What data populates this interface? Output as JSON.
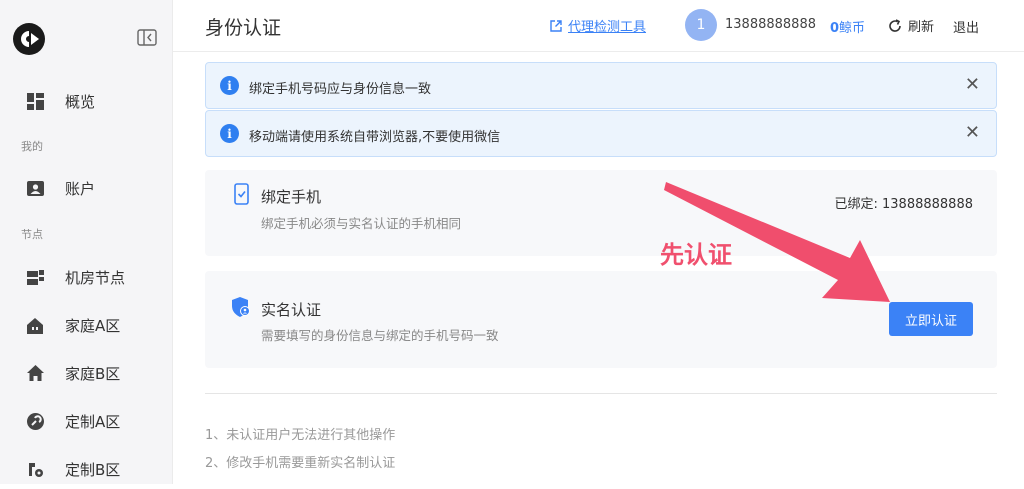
{
  "sidebar": {
    "items": [
      {
        "label": "概览",
        "icon": "dashboard-icon"
      },
      {
        "group": "我的"
      },
      {
        "label": "账户",
        "icon": "account-icon"
      },
      {
        "group": "节点"
      },
      {
        "label": "机房节点",
        "icon": "server-icon"
      },
      {
        "label": "家庭A区",
        "icon": "home-a-icon"
      },
      {
        "label": "家庭B区",
        "icon": "home-b-icon"
      },
      {
        "label": "定制A区",
        "icon": "custom-a-icon"
      },
      {
        "label": "定制B区",
        "icon": "custom-b-icon"
      }
    ]
  },
  "header": {
    "title": "身份认证",
    "proxy_tool": "代理检测工具",
    "avatar": "1",
    "phone": "13888888888",
    "coins_value": "0",
    "coins_unit": "鲸币",
    "refresh": "刷新",
    "logout": "退出"
  },
  "alerts": [
    {
      "text": "绑定手机号码应与身份信息一致"
    },
    {
      "text": "移动端请使用系统自带浏览器,不要使用微信"
    }
  ],
  "bind_phone": {
    "title": "绑定手机",
    "desc": "绑定手机必须与实名认证的手机相同",
    "bound": "已绑定: 13888888888"
  },
  "real_name": {
    "title": "实名认证",
    "desc": "需要填写的身份信息与绑定的手机号码一致",
    "button": "立即认证"
  },
  "annotation": "先认证",
  "notes": [
    "1、未认证用户无法进行其他操作",
    "2、修改手机需要重新实名制认证"
  ],
  "colors": {
    "accent": "#3b82f6",
    "annotation": "#f0506e"
  }
}
